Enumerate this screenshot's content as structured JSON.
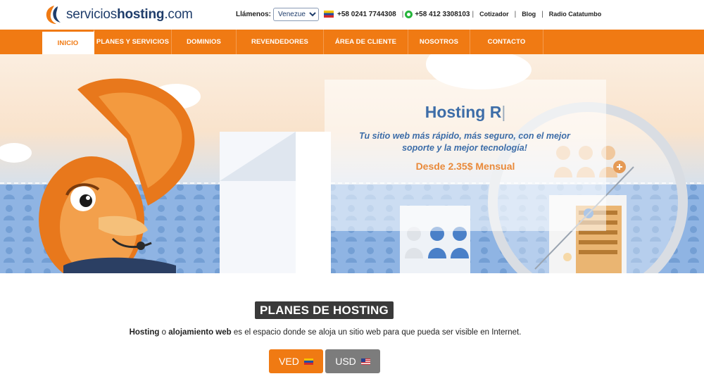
{
  "brand": {
    "name_prefix": "servicios",
    "name_bold": "hosting",
    "name_suffix": ".com"
  },
  "contact": {
    "label": "Llámenos:",
    "country_select": "Venezuela",
    "phone1": "+58 0241 7744308",
    "phone2": "+58 412 3308103",
    "links": [
      "Cotizador",
      "Blog",
      "Radio Catatumbo"
    ]
  },
  "nav": {
    "items": [
      "INICIO",
      "PLANES Y SERVICIOS",
      "DOMINIOS",
      "REVENDEDORES",
      "ÁREA DE CLIENTE",
      "NOSOTROS",
      "CONTACTO"
    ],
    "active": "INICIO"
  },
  "hero": {
    "title": "Hosting R",
    "subtitle": "Tu sitio web más rápido, más seguro, con el mejor soporte y la mejor tecnología!",
    "price": "Desde 2.35$ Mensual"
  },
  "plans": {
    "title": "PLANES DE HOSTING",
    "desc_b1": "Hosting",
    "desc_t1": " o ",
    "desc_b2": "alojamiento web",
    "desc_t2": " es el espacio donde se aloja un sitio web para que pueda ser visible en Internet.",
    "currency_ved": "VED",
    "currency_usd": "USD"
  },
  "colors": {
    "brand_orange": "#f07a13",
    "brand_blue": "#1f3d6b",
    "hero_blue": "#3d6da8"
  }
}
